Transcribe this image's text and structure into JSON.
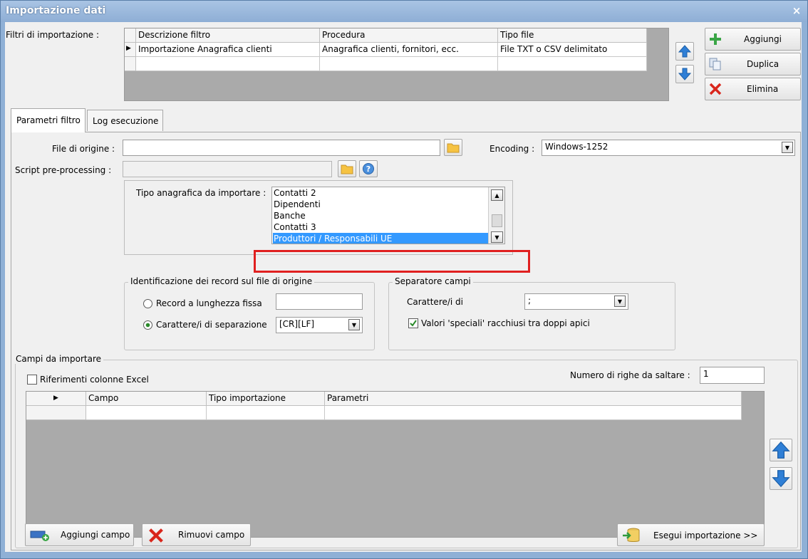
{
  "window": {
    "title": "Importazione dati",
    "close": "×"
  },
  "filters": {
    "label": "Filtri di importazione :",
    "columns": [
      "Descrizione filtro",
      "Procedura",
      "Tipo file"
    ],
    "rows": [
      [
        "Importazione Anagrafica clienti",
        "Anagrafica clienti, fornitori, ecc.",
        "File TXT o CSV delimitato"
      ]
    ],
    "row_marker": "▶"
  },
  "actions": {
    "add": "Aggiungi",
    "duplicate": "Duplica",
    "delete": "Elimina"
  },
  "tabs": [
    {
      "label": "Parametri filtro",
      "active": true
    },
    {
      "label": "Log esecuzione",
      "active": false
    }
  ],
  "params": {
    "source_file_label": "File di origine :",
    "source_file_value": "",
    "encoding_label": "Encoding :",
    "encoding_value": "Windows-1252",
    "script_label": "Script pre-processing :",
    "script_value": "",
    "registry_label": "Tipo anagrafica da importare :",
    "registry_items": [
      "Contatti 2",
      "Dipendenti",
      "Banche",
      "Contatti 3",
      "Produttori / Responsabili UE"
    ],
    "registry_selected": "Produttori / Responsabili UE"
  },
  "record_id": {
    "title": "Identificazione dei record sul file di origine",
    "fixed_label": "Record a lunghezza fissa",
    "fixed_value": "",
    "sep_label": "Carattere/i di separazione",
    "sep_value": "[CR][LF]",
    "selected": "sep"
  },
  "field_sep": {
    "title": "Separatore campi",
    "char_label": "Carattere/i di",
    "char_value": ";",
    "quotes_label": "Valori 'speciali' racchiusi tra doppi apici",
    "quotes_checked": true
  },
  "fields": {
    "title": "Campi da importare",
    "excel_label": "Riferimenti colonne Excel",
    "excel_checked": false,
    "skip_label": "Numero di righe da saltare :",
    "skip_value": "1",
    "columns": [
      "Campo",
      "Tipo importazione",
      "Parametri"
    ],
    "row_marker": "▶"
  },
  "bottom": {
    "add_field": "Aggiungi campo",
    "remove_field": "Rimuovi campo",
    "run": "Esegui importazione >>"
  },
  "colors": {
    "accent": "#3a86d6",
    "highlight": "#e02020",
    "selection": "#3399ff"
  }
}
